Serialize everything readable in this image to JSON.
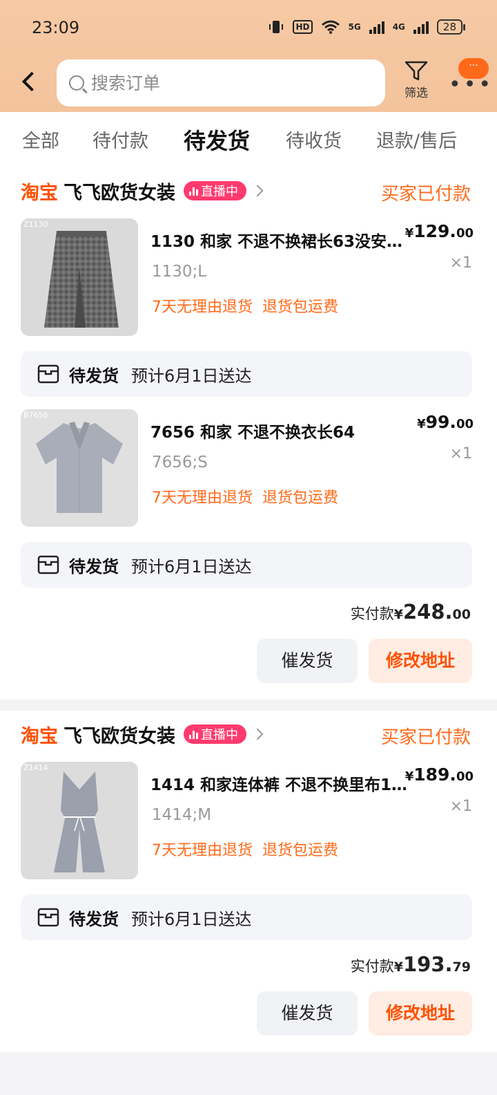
{
  "status_bar": {
    "time": "23:09",
    "hd": "HD",
    "net1": "5G",
    "net2": "4G",
    "battery": "28"
  },
  "header": {
    "search_placeholder": "搜索订单",
    "filter_label": "筛选",
    "more_badge": "···"
  },
  "tabs": [
    {
      "label": "全部",
      "active": false
    },
    {
      "label": "待付款",
      "active": false
    },
    {
      "label": "待发货",
      "active": true
    },
    {
      "label": "待收货",
      "active": false
    },
    {
      "label": "退款/售后",
      "active": false
    }
  ],
  "orders": [
    {
      "brand": "淘宝",
      "shop_name": "飞飞欧货女装",
      "live_label": "直播中",
      "status": "买家已付款",
      "items": [
        {
          "thumb_code": "Z1130",
          "title": "1130 和家 不退不换裙长63没安…",
          "price_yen": "¥",
          "price_int": "129.",
          "price_dec": "00",
          "qty": "×1",
          "sku": "1130;L",
          "tags": [
            "7天无理由退货",
            "退货包运费"
          ],
          "ship_status": "待发货",
          "ship_eta": "预计6月1日送达"
        },
        {
          "thumb_code": "B7656",
          "title": "7656 和家 不退不换衣长64",
          "price_yen": "¥",
          "price_int": "99.",
          "price_dec": "00",
          "qty": "×1",
          "sku": "7656;S",
          "tags": [
            "7天无理由退货",
            "退货包运费"
          ],
          "ship_status": "待发货",
          "ship_eta": "预计6月1日送达"
        }
      ],
      "total_label": "实付款",
      "total_yen": "¥",
      "total_int": "248.",
      "total_dec": "00",
      "buttons": {
        "urge": "催发货",
        "change_address": "修改地址"
      }
    },
    {
      "brand": "淘宝",
      "shop_name": "飞飞欧货女装",
      "live_label": "直播中",
      "status": "买家已付款",
      "items": [
        {
          "thumb_code": "Z1414",
          "title": "1414 和家连体裤 不退不换里布1…",
          "price_yen": "¥",
          "price_int": "189.",
          "price_dec": "00",
          "qty": "×1",
          "sku": "1414;M",
          "tags": [
            "7天无理由退货",
            "退货包运费"
          ],
          "ship_status": "待发货",
          "ship_eta": "预计6月1日送达"
        }
      ],
      "total_label": "实付款",
      "total_yen": "¥",
      "total_int": "193.",
      "total_dec": "79",
      "buttons": {
        "urge": "催发货",
        "change_address": "修改地址"
      }
    }
  ],
  "colors": {
    "accent": "#ff5000",
    "header_bg": "#f6c9a4",
    "live": "#ff3a6e",
    "tag": "#ff6a1a"
  }
}
